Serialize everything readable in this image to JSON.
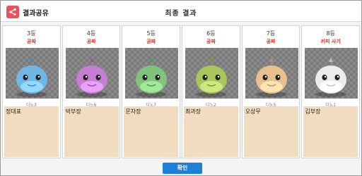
{
  "header": {
    "share_label": "결과공유",
    "title": "최종 결과",
    "share_icon": "share-icon"
  },
  "cards": [
    {
      "rank": "3등",
      "prize": "공짜",
      "character": "디노3",
      "player": "정대표",
      "color": "#6fb7e6"
    },
    {
      "rank": "4등",
      "prize": "공짜",
      "character": "디노6",
      "player": "박부장",
      "color": "#c57ed3"
    },
    {
      "rank": "5등",
      "prize": "공짜",
      "character": "디노7",
      "player": "문차장",
      "color": "#7fc47a"
    },
    {
      "rank": "6등",
      "prize": "공짜",
      "character": "디노2",
      "player": "최과장",
      "color": "#a8c65a"
    },
    {
      "rank": "7등",
      "prize": "공짜",
      "character": "디노5",
      "player": "오상무",
      "color": "#e8c08e"
    },
    {
      "rank": "8등",
      "prize": "커피 사기",
      "character": "디노1",
      "player": "김부장",
      "color": "#ececec"
    }
  ],
  "confirm_label": "확인",
  "colors": {
    "prize": "#e02a1c",
    "confirm": "#1e7fd8",
    "note_bg": "#f2dcc0",
    "share": "#ea4f5b"
  }
}
